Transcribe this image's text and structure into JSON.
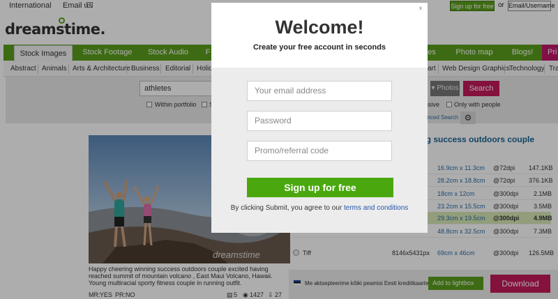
{
  "topbar": {
    "international": "International",
    "email_us": "Email us",
    "signup": "Sign up for free",
    "or": "or",
    "login": "Email/Username"
  },
  "logo": "dreamstime.",
  "nav": {
    "items": [
      "Stock Images",
      "Stock Footage",
      "Stock Audio",
      "F",
      "es",
      "Photo map",
      "Blogs!",
      "Pri"
    ]
  },
  "categories": [
    "Abstract",
    "Animals",
    "Arts & Architecture",
    "Business",
    "Editorial",
    "Holid",
    "art",
    "Web Design Graphics",
    "Technology",
    "Tra"
  ],
  "search": {
    "value": "athletes",
    "within_portfolio": "Within portfolio",
    "s_label": "S",
    "exclusive": "usive",
    "only_people": "Only with people",
    "type": "Photos",
    "button": "Search",
    "advanced": "anced Search"
  },
  "image": {
    "watermark": "dreamstime",
    "caption": "Happy cheering winning success outdoors couple excited having reached summit of mountain volcano , East Maui Volcano, Hawaii. Young multiracial sporty fitness couple in running outfit.",
    "mr_label": "MR:",
    "mr_value": "YES",
    "pr_label": "PR:",
    "pr_value": "NO",
    "stats": [
      "5",
      "1427",
      "27"
    ]
  },
  "right": {
    "title": "ing success outdoors couple",
    "sizes": [
      {
        "name": "",
        "px": "",
        "cm": "16.9cm x 11.3cm",
        "dpi": "@72dpi",
        "size": "147.1KB"
      },
      {
        "name": "",
        "px": "",
        "cm": "28.2cm x 18.8cm",
        "dpi": "@72dpi",
        "size": "376.1KB"
      },
      {
        "name": "",
        "px": "",
        "cm": "18cm x 12cm",
        "dpi": "@300dpi",
        "size": "2.1MB"
      },
      {
        "name": "",
        "px": "",
        "cm": "23.2cm x 15.5cm",
        "dpi": "@300dpi",
        "size": "3.5MB"
      },
      {
        "name": "",
        "px": "",
        "cm": "29.3cm x 19.5cm",
        "dpi": "@300dpi",
        "size": "4.9MB"
      },
      {
        "name": "",
        "px": "",
        "cm": "48.8cm x 32.5cm",
        "dpi": "@300dpi",
        "size": "7.3MB"
      },
      {
        "name": "Tiff",
        "px": "8146x5431px",
        "cm": "69cm x 46cm",
        "dpi": "@300dpi",
        "size": "126.5MB"
      }
    ],
    "estonian": "Me aktsepteerime kõiki peamisi Eesti krediitkaarte.",
    "lightbox": "Add to lightbox",
    "download": "Download"
  },
  "modal": {
    "title": "Welcome!",
    "subtitle": "Create your free account in seconds",
    "email_placeholder": "Your email address",
    "password_placeholder": "Password",
    "promo_placeholder": "Promo/referral code",
    "signup_button": "Sign up for free",
    "terms_prefix": "By clicking Submit, you agree to our ",
    "terms_link": "terms and conditions",
    "close": "x"
  }
}
